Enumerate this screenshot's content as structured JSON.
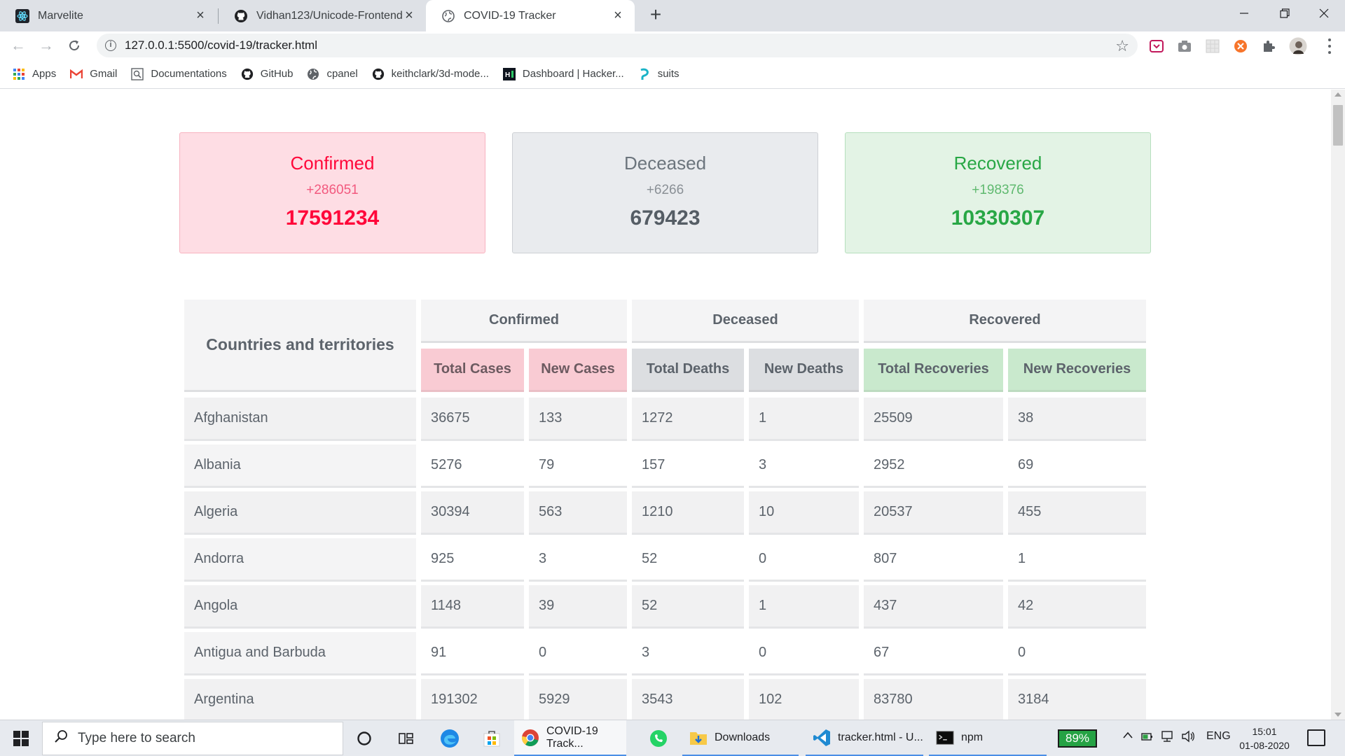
{
  "browser": {
    "tabs": [
      {
        "title": "Marvelite",
        "active": false
      },
      {
        "title": "Vidhan123/Unicode-Frontend",
        "active": false
      },
      {
        "title": "COVID-19 Tracker",
        "active": true
      }
    ],
    "url": "127.0.0.1:5500/covid-19/tracker.html",
    "bookmarks": [
      {
        "label": "Apps",
        "icon": "apps-grid-icon"
      },
      {
        "label": "Gmail",
        "icon": "gmail-icon"
      },
      {
        "label": "Documentations",
        "icon": "doc-search-icon"
      },
      {
        "label": "GitHub",
        "icon": "github-icon"
      },
      {
        "label": "cpanel",
        "icon": "globe-icon"
      },
      {
        "label": "keithclark/3d-mode...",
        "icon": "github-icon"
      },
      {
        "label": "Dashboard | Hacker...",
        "icon": "hackerrank-icon"
      },
      {
        "label": "suits",
        "icon": "suits-icon"
      }
    ]
  },
  "summary": {
    "confirmed": {
      "title": "Confirmed",
      "delta": "+286051",
      "total": "17591234"
    },
    "deceased": {
      "title": "Deceased",
      "delta": "+6266",
      "total": "679423"
    },
    "recovered": {
      "title": "Recovered",
      "delta": "+198376",
      "total": "10330307"
    }
  },
  "table": {
    "country_header": "Countries and territories",
    "groups": {
      "confirmed": "Confirmed",
      "deceased": "Deceased",
      "recovered": "Recovered"
    },
    "columns": [
      "Total Cases",
      "New Cases",
      "Total Deaths",
      "New Deaths",
      "Total Recoveries",
      "New Recoveries"
    ],
    "rows": [
      {
        "country": "Afghanistan",
        "values": [
          "36675",
          "133",
          "1272",
          "1",
          "25509",
          "38"
        ]
      },
      {
        "country": "Albania",
        "values": [
          "5276",
          "79",
          "157",
          "3",
          "2952",
          "69"
        ]
      },
      {
        "country": "Algeria",
        "values": [
          "30394",
          "563",
          "1210",
          "10",
          "20537",
          "455"
        ]
      },
      {
        "country": "Andorra",
        "values": [
          "925",
          "3",
          "52",
          "0",
          "807",
          "1"
        ]
      },
      {
        "country": "Angola",
        "values": [
          "1148",
          "39",
          "52",
          "1",
          "437",
          "42"
        ]
      },
      {
        "country": "Antigua and Barbuda",
        "values": [
          "91",
          "0",
          "3",
          "0",
          "67",
          "0"
        ]
      },
      {
        "country": "Argentina",
        "values": [
          "191302",
          "5929",
          "3543",
          "102",
          "83780",
          "3184"
        ]
      }
    ]
  },
  "taskbar": {
    "search_placeholder": "Type here to search",
    "apps": [
      {
        "label": "COVID-19 Track...",
        "icon": "chrome-icon"
      },
      {
        "label": "Downloads",
        "icon": "folder-icon"
      },
      {
        "label": "tracker.html - U...",
        "icon": "vscode-icon"
      },
      {
        "label": "npm",
        "icon": "terminal-icon"
      }
    ],
    "battery": "89%",
    "language": "ENG",
    "time": "15:01",
    "date": "01-08-2020"
  },
  "colors": {
    "confirmed": "#ff073a",
    "deceased": "#6c757d",
    "recovered": "#28a745"
  }
}
